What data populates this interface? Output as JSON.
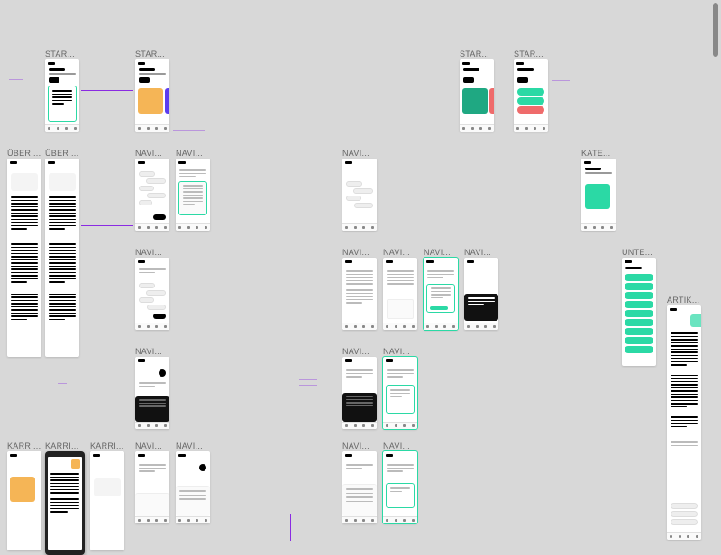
{
  "labels": {
    "star": "STAR...",
    "uber": "ÜBER ...",
    "navi": "NAVI...",
    "kate": "KATE...",
    "unte": "UNTE...",
    "artik": "ARTIK...",
    "karri": "KARRI..."
  },
  "colors": {
    "orange": "#f5b556",
    "purple": "#5b3cf0",
    "red": "#ef6b6b",
    "teal": "#2bd9a5",
    "darkteal": "#1fa882",
    "black": "#000"
  }
}
